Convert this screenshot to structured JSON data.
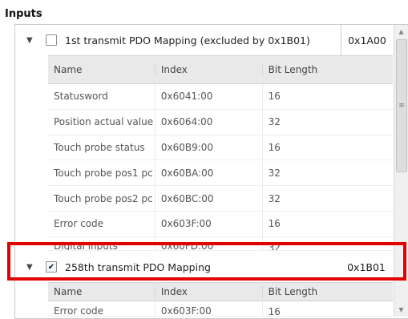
{
  "section_title": "Inputs",
  "groups": [
    {
      "name": "1st transmit PDO Mapping (excluded by 0x1B01)",
      "index": "0x1A00",
      "checked": false,
      "columns": [
        "Name",
        "Index",
        "Bit Length"
      ],
      "rows": [
        {
          "name": "Statusword",
          "index": "0x6041:00",
          "bits": "16"
        },
        {
          "name": "Position actual value",
          "index": "0x6064:00",
          "bits": "32"
        },
        {
          "name": "Touch probe status",
          "index": "0x60B9:00",
          "bits": "16"
        },
        {
          "name": "Touch probe pos1 pc",
          "index": "0x60BA:00",
          "bits": "32"
        },
        {
          "name": "Touch probe pos2 pc",
          "index": "0x60BC:00",
          "bits": "32"
        },
        {
          "name": "Error code",
          "index": "0x603F:00",
          "bits": "16"
        },
        {
          "name": "Digital inputs",
          "index": "0x60FD:00",
          "bits": "32"
        }
      ]
    },
    {
      "name": "258th transmit PDO Mapping",
      "index": "0x1B01",
      "checked": true,
      "columns": [
        "Name",
        "Index",
        "Bit Length"
      ],
      "rows": [
        {
          "name": "Error code",
          "index": "0x603F:00",
          "bits": "16"
        }
      ]
    }
  ],
  "icons": {
    "expand": "triangle-down-icon",
    "checkbox_unchecked": "checkbox-empty",
    "checkbox_checked": "checkbox-checked",
    "scroll_grip": "grip-lines-icon"
  },
  "colors": {
    "highlight": "#e30000",
    "header_bg": "#e9e9e9"
  }
}
